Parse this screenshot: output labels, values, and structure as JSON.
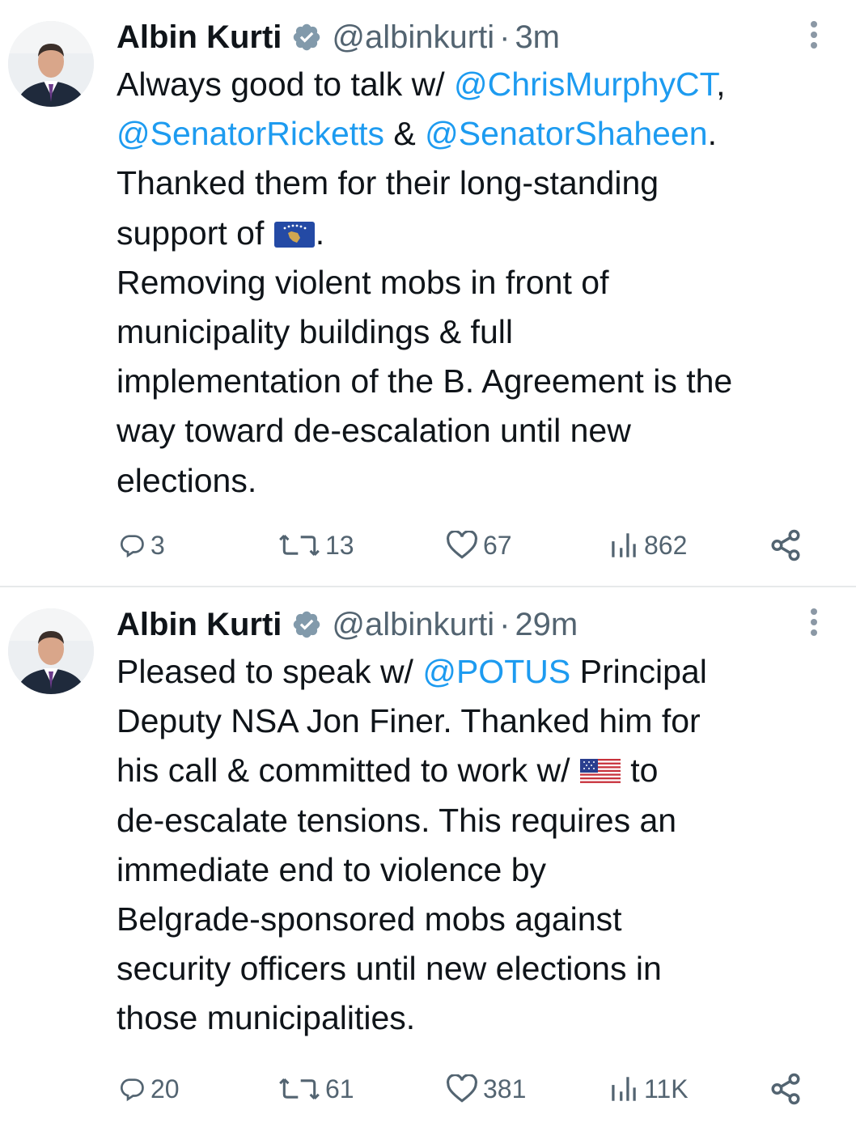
{
  "tweets": [
    {
      "author_name": "Albin Kurti",
      "handle": "@albinkurti",
      "separator": "·",
      "time": "3m",
      "lines": [
        [
          {
            "t": "Always good to talk w/ "
          },
          {
            "t": "@ChrisMurphyCT",
            "m": true
          },
          {
            "t": ","
          }
        ],
        [
          {
            "t": "@SenatorRicketts",
            "m": true
          },
          {
            "t": " & "
          },
          {
            "t": "@SenatorShaheen",
            "m": true
          },
          {
            "t": "."
          }
        ],
        [
          {
            "t": "Thanked them for their long-standing"
          }
        ],
        [
          {
            "t": "support of "
          },
          {
            "flag": "kosovo-flag"
          },
          {
            "t": "."
          }
        ],
        [
          {
            "t": "Removing violent mobs in front of"
          }
        ],
        [
          {
            "t": "municipality buildings & full"
          }
        ],
        [
          {
            "t": "implementation of the B. Agreement is the"
          }
        ],
        [
          {
            "t": "way toward de-escalation until new"
          }
        ],
        [
          {
            "t": "elections."
          }
        ]
      ],
      "stats": {
        "replies": "3",
        "retweets": "13",
        "likes": "67",
        "views": "862"
      }
    },
    {
      "author_name": "Albin Kurti",
      "handle": "@albinkurti",
      "separator": "·",
      "time": "29m",
      "lines": [
        [
          {
            "t": "Pleased to speak w/ "
          },
          {
            "t": "@POTUS",
            "m": true
          },
          {
            "t": " Principal"
          }
        ],
        [
          {
            "t": "Deputy NSA Jon Finer. Thanked him for"
          }
        ],
        [
          {
            "t": "his call & committed to work w/ "
          },
          {
            "flag": "us-flag"
          },
          {
            "t": " to"
          }
        ],
        [
          {
            "t": "de-escalate tensions. This requires an"
          }
        ],
        [
          {
            "t": "immediate end to violence by"
          }
        ],
        [
          {
            "t": "Belgrade-sponsored mobs against"
          }
        ],
        [
          {
            "t": "security officers until new elections in"
          }
        ],
        [
          {
            "t": "those municipalities."
          }
        ]
      ],
      "stats": {
        "replies": "20",
        "retweets": "61",
        "likes": "381",
        "views": "11K"
      }
    }
  ],
  "icons": {
    "verified": "verified-badge-icon",
    "more": "more-options-icon",
    "reply": "reply-icon",
    "retweet": "retweet-icon",
    "like": "heart-icon",
    "views": "views-chart-icon",
    "share": "share-icon"
  },
  "colors": {
    "mention": "#1d9bf0",
    "secondary_text": "#536471",
    "verified_badge": "#829aab",
    "divider": "#e7e9ea"
  }
}
